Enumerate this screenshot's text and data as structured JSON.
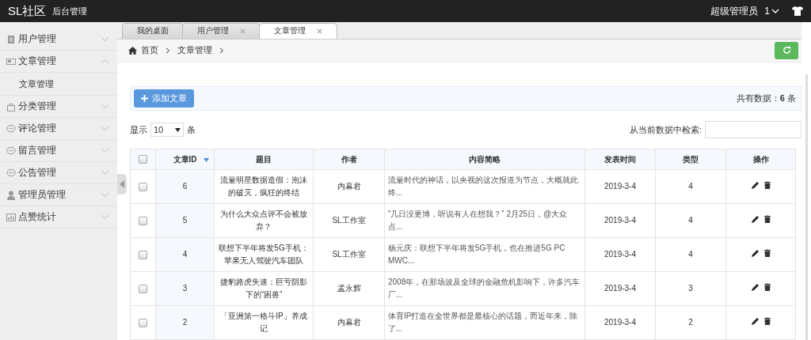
{
  "header": {
    "logo": "SL社区",
    "subtitle": "后台管理",
    "user": "超级管理员",
    "user_menu": "1"
  },
  "sidebar": {
    "items": [
      {
        "kind": "doc",
        "label": "用户管理",
        "expanded": false
      },
      {
        "kind": "card",
        "label": "文章管理",
        "expanded": true,
        "children": [
          {
            "label": "文章管理"
          }
        ]
      },
      {
        "kind": "bag",
        "label": "分类管理",
        "expanded": false
      },
      {
        "kind": "chat",
        "label": "评论管理",
        "expanded": false
      },
      {
        "kind": "chat",
        "label": "留言管理",
        "expanded": false
      },
      {
        "kind": "chat",
        "label": "公告管理",
        "expanded": false
      },
      {
        "kind": "user",
        "label": "管理员管理",
        "expanded": false
      },
      {
        "kind": "chart",
        "label": "点赞统计",
        "expanded": false
      }
    ]
  },
  "tabs": [
    {
      "label": "我的桌面",
      "selected": false,
      "closable": false
    },
    {
      "label": "用户管理",
      "selected": false,
      "closable": true
    },
    {
      "label": "文章管理",
      "selected": true,
      "closable": true
    }
  ],
  "breadcrumb": [
    "首页",
    "文章管理"
  ],
  "toolbar": {
    "add_button": "添加文章",
    "total": "共有数据：**6** 条"
  },
  "length_control": {
    "before": "显示",
    "value": "10",
    "after": "条"
  },
  "search": {
    "label": "从当前数据中检索:"
  },
  "table": {
    "select_all": {
      "checked": false
    },
    "columns": [
      {
        "label": "文章ID",
        "sorted": true
      },
      {
        "label": "题目",
        "sorted": false
      },
      {
        "label": "作者",
        "sorted": false
      },
      {
        "label": "内容简略",
        "sorted": false
      },
      {
        "label": "发表时间",
        "sorted": false
      },
      {
        "label": "类型",
        "sorted": false
      },
      {
        "label": "操作",
        "sorted": false
      }
    ],
    "rows": [
      {
        "selected": false,
        "id": "6",
        "title": "流量明星数据造假：泡沫的破灭，疯狂的终结",
        "author": "内幕君",
        "summary": "流量时代的神话，以央视的这次报道为节点，大概就此终...",
        "date": "2019-3-4",
        "type": "4"
      },
      {
        "selected": false,
        "id": "5",
        "title": "为什么大众点评不会被放弃？",
        "author": "SL工作室",
        "summary": "“几日没更博，听说有人在想我？” 2月25日，@大众点...",
        "date": "2019-3-4",
        "type": "4"
      },
      {
        "selected": false,
        "id": "4",
        "title": "联想下半年将发5G手机：苹果无人驾驶汽车团队",
        "author": "SL工作室",
        "summary": "杨元庆：联想下半年将发5G手机，也在推进5G PC MWC...",
        "date": "2019-3-4",
        "type": "4"
      },
      {
        "selected": false,
        "id": "3",
        "title": "捷豹路虎失速：巨亏阴影下的“困兽”",
        "author": "孟永辉",
        "summary": "2008年，在那场波及全球的金融危机影响下，许多汽车厂...",
        "date": "2019-3-4",
        "type": "3"
      },
      {
        "selected": false,
        "id": "2",
        "title": "「亚洲第一格斗IP」养成记",
        "author": "内幕君",
        "summary": "体育IP打造在全世界都是最核心的话题，而近年来，除了...",
        "date": "2019-3-4",
        "type": "2"
      }
    ]
  }
}
